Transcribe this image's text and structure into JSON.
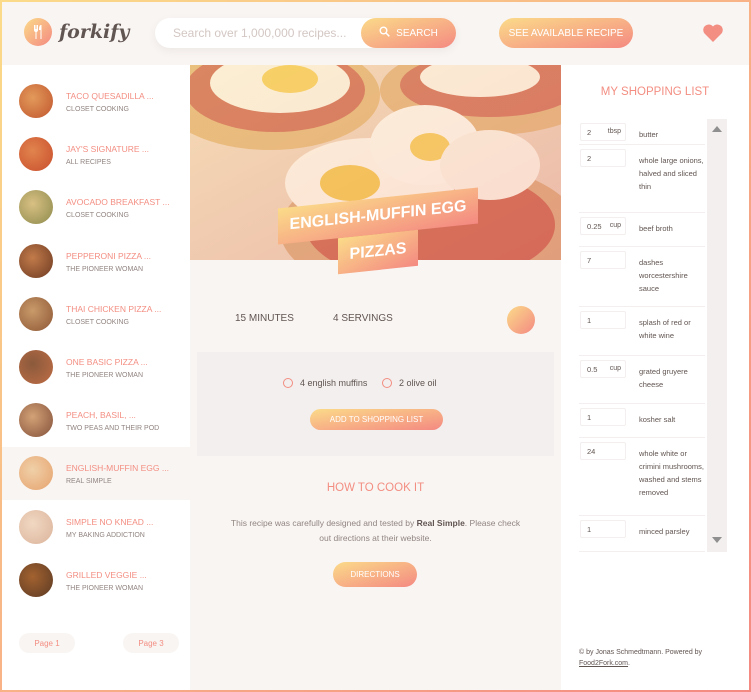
{
  "header": {
    "logo_text": "forkify",
    "search_placeholder": "Search over 1,000,000 recipes...",
    "search_label": "SEARCH",
    "see_recipe_label": "SEE AVAILABLE RECIPE"
  },
  "results": [
    {
      "title": "TACO QUESADILLA ...",
      "publisher": "CLOSET COOKING"
    },
    {
      "title": "JAY'S SIGNATURE ...",
      "publisher": "ALL RECIPES"
    },
    {
      "title": "AVOCADO BREAKFAST ...",
      "publisher": "CLOSET COOKING"
    },
    {
      "title": "PEPPERONI PIZZA ...",
      "publisher": "THE PIONEER WOMAN"
    },
    {
      "title": "THAI CHICKEN PIZZA ...",
      "publisher": "CLOSET COOKING"
    },
    {
      "title": "ONE BASIC PIZZA ...",
      "publisher": "THE PIONEER WOMAN"
    },
    {
      "title": "PEACH, BASIL, ...",
      "publisher": "TWO PEAS AND THEIR POD"
    },
    {
      "title": "ENGLISH-MUFFIN EGG ...",
      "publisher": "REAL SIMPLE"
    },
    {
      "title": "SIMPLE NO KNEAD ...",
      "publisher": "MY BAKING ADDICTION"
    },
    {
      "title": "GRILLED VEGGIE ...",
      "publisher": "THE PIONEER WOMAN"
    }
  ],
  "pagination": {
    "prev": "Page 1",
    "next": "Page 3"
  },
  "recipe": {
    "title_line1": "ENGLISH-MUFFIN EGG",
    "title_line2": "PIZZAS",
    "minutes": "15 MINUTES",
    "servings": "4 SERVINGS",
    "ingredients": [
      {
        "count": "4",
        "text": "english muffins"
      },
      {
        "count": "2",
        "text": "olive oil"
      }
    ],
    "add_label": "ADD TO SHOPPING LIST",
    "how_heading": "HOW TO COOK IT",
    "dir_text_1": "This recipe was carefully designed and tested by",
    "publisher": "Real Simple",
    "dir_text_2": ". Please check out directions at their website.",
    "directions_label": "DIRECTIONS"
  },
  "shopping": {
    "title": "MY SHOPPING LIST",
    "items": [
      {
        "count": "2",
        "unit": "tbsp",
        "desc": "butter"
      },
      {
        "count": "2",
        "unit": "",
        "desc": "whole large onions, halved and sliced thin"
      },
      {
        "count": "0.25",
        "unit": "cup",
        "desc": "beef broth"
      },
      {
        "count": "7",
        "unit": "",
        "desc": "dashes worcestershire sauce"
      },
      {
        "count": "1",
        "unit": "",
        "desc": "splash of red or white wine"
      },
      {
        "count": "0.5",
        "unit": "cup",
        "desc": "grated gruyere cheese"
      },
      {
        "count": "1",
        "unit": "",
        "desc": "kosher salt"
      },
      {
        "count": "24",
        "unit": "",
        "desc": "whole white or crimini mushrooms, washed and stems removed"
      },
      {
        "count": "1",
        "unit": "",
        "desc": "minced parsley"
      }
    ],
    "footer_text": "© by Jonas Schmedtmann. Powered by",
    "footer_link": "Food2Fork.com"
  },
  "colors": {
    "accent": "#f38e82",
    "grad_start": "#fbdb89",
    "grad_end": "#f48982"
  }
}
